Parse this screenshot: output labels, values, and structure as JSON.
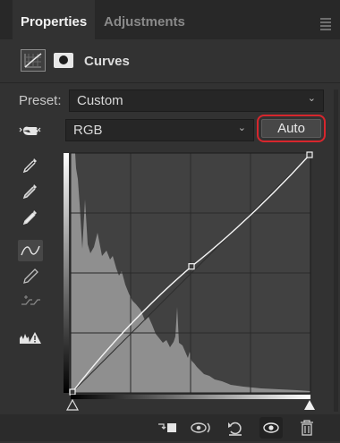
{
  "tabs": [
    {
      "label": "Properties"
    },
    {
      "label": "Adjustments"
    }
  ],
  "header": {
    "title": "Curves"
  },
  "preset": {
    "label": "Preset:",
    "value": "Custom"
  },
  "channel": {
    "value": "RGB"
  },
  "auto_button": {
    "label": "Auto"
  },
  "colors": {
    "highlight_outline": "#d7262d",
    "panel_bg": "#323232"
  },
  "curve_points": [
    {
      "input": 0,
      "output": 0
    },
    {
      "input": 128,
      "output": 135
    },
    {
      "input": 255,
      "output": 255
    }
  ],
  "icons": {
    "tools": [
      "on-image-adjust-icon",
      "black-point-eyedropper-icon",
      "gray-point-eyedropper-icon",
      "white-point-eyedropper-icon",
      "curve-points-icon",
      "pencil-icon",
      "smooth-icon",
      "clipping-warning-icon"
    ],
    "bottom": [
      "clip-to-layer-icon",
      "view-previous-icon",
      "reset-icon",
      "visibility-icon",
      "delete-icon"
    ]
  }
}
